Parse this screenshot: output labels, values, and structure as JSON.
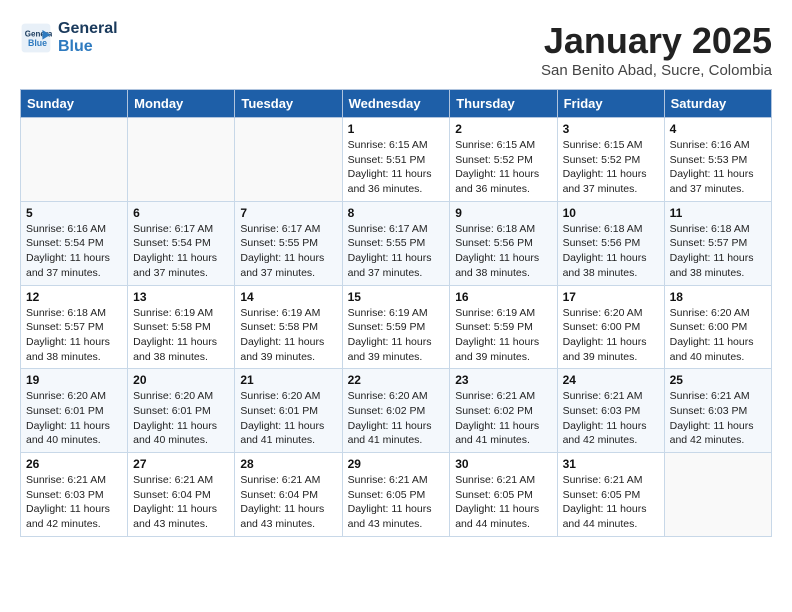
{
  "header": {
    "logo_line1": "General",
    "logo_line2": "Blue",
    "title": "January 2025",
    "subtitle": "San Benito Abad, Sucre, Colombia"
  },
  "weekdays": [
    "Sunday",
    "Monday",
    "Tuesday",
    "Wednesday",
    "Thursday",
    "Friday",
    "Saturday"
  ],
  "weeks": [
    [
      {
        "day": "",
        "info": ""
      },
      {
        "day": "",
        "info": ""
      },
      {
        "day": "",
        "info": ""
      },
      {
        "day": "1",
        "info": "Sunrise: 6:15 AM\nSunset: 5:51 PM\nDaylight: 11 hours\nand 36 minutes."
      },
      {
        "day": "2",
        "info": "Sunrise: 6:15 AM\nSunset: 5:52 PM\nDaylight: 11 hours\nand 36 minutes."
      },
      {
        "day": "3",
        "info": "Sunrise: 6:15 AM\nSunset: 5:52 PM\nDaylight: 11 hours\nand 37 minutes."
      },
      {
        "day": "4",
        "info": "Sunrise: 6:16 AM\nSunset: 5:53 PM\nDaylight: 11 hours\nand 37 minutes."
      }
    ],
    [
      {
        "day": "5",
        "info": "Sunrise: 6:16 AM\nSunset: 5:54 PM\nDaylight: 11 hours\nand 37 minutes."
      },
      {
        "day": "6",
        "info": "Sunrise: 6:17 AM\nSunset: 5:54 PM\nDaylight: 11 hours\nand 37 minutes."
      },
      {
        "day": "7",
        "info": "Sunrise: 6:17 AM\nSunset: 5:55 PM\nDaylight: 11 hours\nand 37 minutes."
      },
      {
        "day": "8",
        "info": "Sunrise: 6:17 AM\nSunset: 5:55 PM\nDaylight: 11 hours\nand 37 minutes."
      },
      {
        "day": "9",
        "info": "Sunrise: 6:18 AM\nSunset: 5:56 PM\nDaylight: 11 hours\nand 38 minutes."
      },
      {
        "day": "10",
        "info": "Sunrise: 6:18 AM\nSunset: 5:56 PM\nDaylight: 11 hours\nand 38 minutes."
      },
      {
        "day": "11",
        "info": "Sunrise: 6:18 AM\nSunset: 5:57 PM\nDaylight: 11 hours\nand 38 minutes."
      }
    ],
    [
      {
        "day": "12",
        "info": "Sunrise: 6:18 AM\nSunset: 5:57 PM\nDaylight: 11 hours\nand 38 minutes."
      },
      {
        "day": "13",
        "info": "Sunrise: 6:19 AM\nSunset: 5:58 PM\nDaylight: 11 hours\nand 38 minutes."
      },
      {
        "day": "14",
        "info": "Sunrise: 6:19 AM\nSunset: 5:58 PM\nDaylight: 11 hours\nand 39 minutes."
      },
      {
        "day": "15",
        "info": "Sunrise: 6:19 AM\nSunset: 5:59 PM\nDaylight: 11 hours\nand 39 minutes."
      },
      {
        "day": "16",
        "info": "Sunrise: 6:19 AM\nSunset: 5:59 PM\nDaylight: 11 hours\nand 39 minutes."
      },
      {
        "day": "17",
        "info": "Sunrise: 6:20 AM\nSunset: 6:00 PM\nDaylight: 11 hours\nand 39 minutes."
      },
      {
        "day": "18",
        "info": "Sunrise: 6:20 AM\nSunset: 6:00 PM\nDaylight: 11 hours\nand 40 minutes."
      }
    ],
    [
      {
        "day": "19",
        "info": "Sunrise: 6:20 AM\nSunset: 6:01 PM\nDaylight: 11 hours\nand 40 minutes."
      },
      {
        "day": "20",
        "info": "Sunrise: 6:20 AM\nSunset: 6:01 PM\nDaylight: 11 hours\nand 40 minutes."
      },
      {
        "day": "21",
        "info": "Sunrise: 6:20 AM\nSunset: 6:01 PM\nDaylight: 11 hours\nand 41 minutes."
      },
      {
        "day": "22",
        "info": "Sunrise: 6:20 AM\nSunset: 6:02 PM\nDaylight: 11 hours\nand 41 minutes."
      },
      {
        "day": "23",
        "info": "Sunrise: 6:21 AM\nSunset: 6:02 PM\nDaylight: 11 hours\nand 41 minutes."
      },
      {
        "day": "24",
        "info": "Sunrise: 6:21 AM\nSunset: 6:03 PM\nDaylight: 11 hours\nand 42 minutes."
      },
      {
        "day": "25",
        "info": "Sunrise: 6:21 AM\nSunset: 6:03 PM\nDaylight: 11 hours\nand 42 minutes."
      }
    ],
    [
      {
        "day": "26",
        "info": "Sunrise: 6:21 AM\nSunset: 6:03 PM\nDaylight: 11 hours\nand 42 minutes."
      },
      {
        "day": "27",
        "info": "Sunrise: 6:21 AM\nSunset: 6:04 PM\nDaylight: 11 hours\nand 43 minutes."
      },
      {
        "day": "28",
        "info": "Sunrise: 6:21 AM\nSunset: 6:04 PM\nDaylight: 11 hours\nand 43 minutes."
      },
      {
        "day": "29",
        "info": "Sunrise: 6:21 AM\nSunset: 6:05 PM\nDaylight: 11 hours\nand 43 minutes."
      },
      {
        "day": "30",
        "info": "Sunrise: 6:21 AM\nSunset: 6:05 PM\nDaylight: 11 hours\nand 44 minutes."
      },
      {
        "day": "31",
        "info": "Sunrise: 6:21 AM\nSunset: 6:05 PM\nDaylight: 11 hours\nand 44 minutes."
      },
      {
        "day": "",
        "info": ""
      }
    ]
  ]
}
